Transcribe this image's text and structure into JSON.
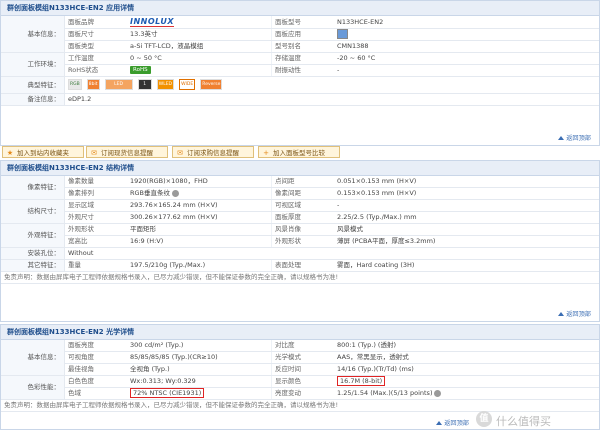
{
  "sec1": {
    "title": "群创面板模组N133HCE-EN2 应用详情",
    "brand_logo": "INNOLUX",
    "rows": {
      "brand_label": "面板品牌",
      "model_label": "面板型号",
      "model_value": "N133HCE-EN2",
      "size_label": "面板尺寸",
      "size_value": "13.3英寸",
      "app_label": "面板应用",
      "type_label": "面板类型",
      "type_value": "a-Si TFT-LCD，液晶模组",
      "alias_label": "型号别名",
      "alias_value": "CMN1388",
      "optemp_label": "工作温度",
      "optemp_value": "0 ~ 50 °C",
      "sttemp_label": "存储温度",
      "sttemp_value": "-20 ~ 60 °C",
      "rohs_label": "RoHS状态",
      "rohs_value": "RoHS",
      "vib_label": "耐振动性",
      "vib_value": "-",
      "note_value": "eDP1.2"
    },
    "groups": {
      "basic": "基本信息：",
      "env": "工作环境：",
      "feature": "典型特征：",
      "note": "备注信息："
    },
    "features": [
      "RGB",
      "8bit",
      "LED",
      "1",
      "WLED",
      "WIDE",
      "Reverse"
    ],
    "back": "返回顶部"
  },
  "buttons": [
    "加入到站内收藏夹",
    "订阅现货信息提醒",
    "订阅求购信息提醒",
    "加入面板型号比较"
  ],
  "sec2": {
    "title": "群创面板模组N133HCE-EN2 结构详情",
    "groups": {
      "pixel": "像素特征：",
      "struct": "结构尺寸：",
      "shape": "外观特征：",
      "mount": "安装孔位：",
      "other": "其它特征："
    },
    "rows": {
      "res_label": "像素数量",
      "res_value": "1920(RGB)×1080，FHD",
      "pitch_label": "点间距",
      "pitch_value": "0.051×0.153 mm (H×V)",
      "arr_label": "像素排列",
      "arr_value": "RGB垂直条纹",
      "ppitch_label": "像素间距",
      "ppitch_value": "0.153×0.153 mm (H×V)",
      "area_label": "显示区域",
      "area_value": "293.76×165.24 mm (H×V)",
      "vis_label": "可视区域",
      "vis_value": "-",
      "outline_label": "外观尺寸",
      "outline_value": "300.26×177.62 mm (H×V)",
      "thick_label": "面板厚度",
      "thick_value": "2.25/2.5 (Typ./Max.) mm",
      "shape_label": "外观形状",
      "shape_value": "平面矩形",
      "bezel_label": "风景肖像",
      "bezel_value": "风景模式",
      "ratio_label": "宽高比",
      "ratio_value": "16:9 (H:V)",
      "form_label": "外观形状",
      "form_value": "薄屏 (PCBA平面，厚度≤3.2mm)",
      "mount_value": "Without",
      "weight_label": "重量",
      "weight_value": "197.5/210g (Typ./Max.)",
      "surface_label": "表面处理",
      "surface_value": "雾面，Hard coating (3H)"
    },
    "disclaimer": "免责声明：数据由屏库电子工程师依据规格书录入，已尽力减少错误，但不能保证参数的完全正确，请以规格书为准!",
    "back": "返回顶部"
  },
  "sec3": {
    "title": "群创面板模组N133HCE-EN2 光学详情",
    "groups": {
      "basic": "基本信息：",
      "color": "色彩性能："
    },
    "rows": {
      "bright_label": "面板亮度",
      "bright_value": "300 cd/m² (Typ.)",
      "contrast_label": "对比度",
      "contrast_value": "800:1 (Typ.) (透射)",
      "view_label": "可视角度",
      "view_value": "85/85/85/85 (Typ.)(CR≥10)",
      "mode_label": "光学模式",
      "mode_value": "AAS，常黑显示，透射式",
      "best_label": "最佳视角",
      "best_value": "全视角 (Typ.)",
      "resp_label": "反应时间",
      "resp_value": "14/16 (Typ.)(Tr/Td) (ms)",
      "white_label": "白色色度",
      "white_value": "Wx:0.313; Wy:0.329",
      "colors_label": "显示颜色",
      "colors_value": "16.7M (8-bit)",
      "gamut_label": "色域",
      "gamut_value": "72% NTSC (CIE1931)",
      "uni_label": "亮度变动",
      "uni_value": "1.25/1.54 (Max.)(5/13 points)"
    },
    "disclaimer": "免责声明：数据由屏库电子工程师依据规格书录入，已尽力减少错误，但不能保证参数的完全正确，请以规格书为准!",
    "back": "返回顶部"
  },
  "watermark": "什么值得买",
  "watermark_icon": "值",
  "colors": {
    "header_text": "#1f4e8c",
    "header_bg": "#e8eef7",
    "rohs_green": "#3a9c2c",
    "highlight_red": "#e02424"
  }
}
